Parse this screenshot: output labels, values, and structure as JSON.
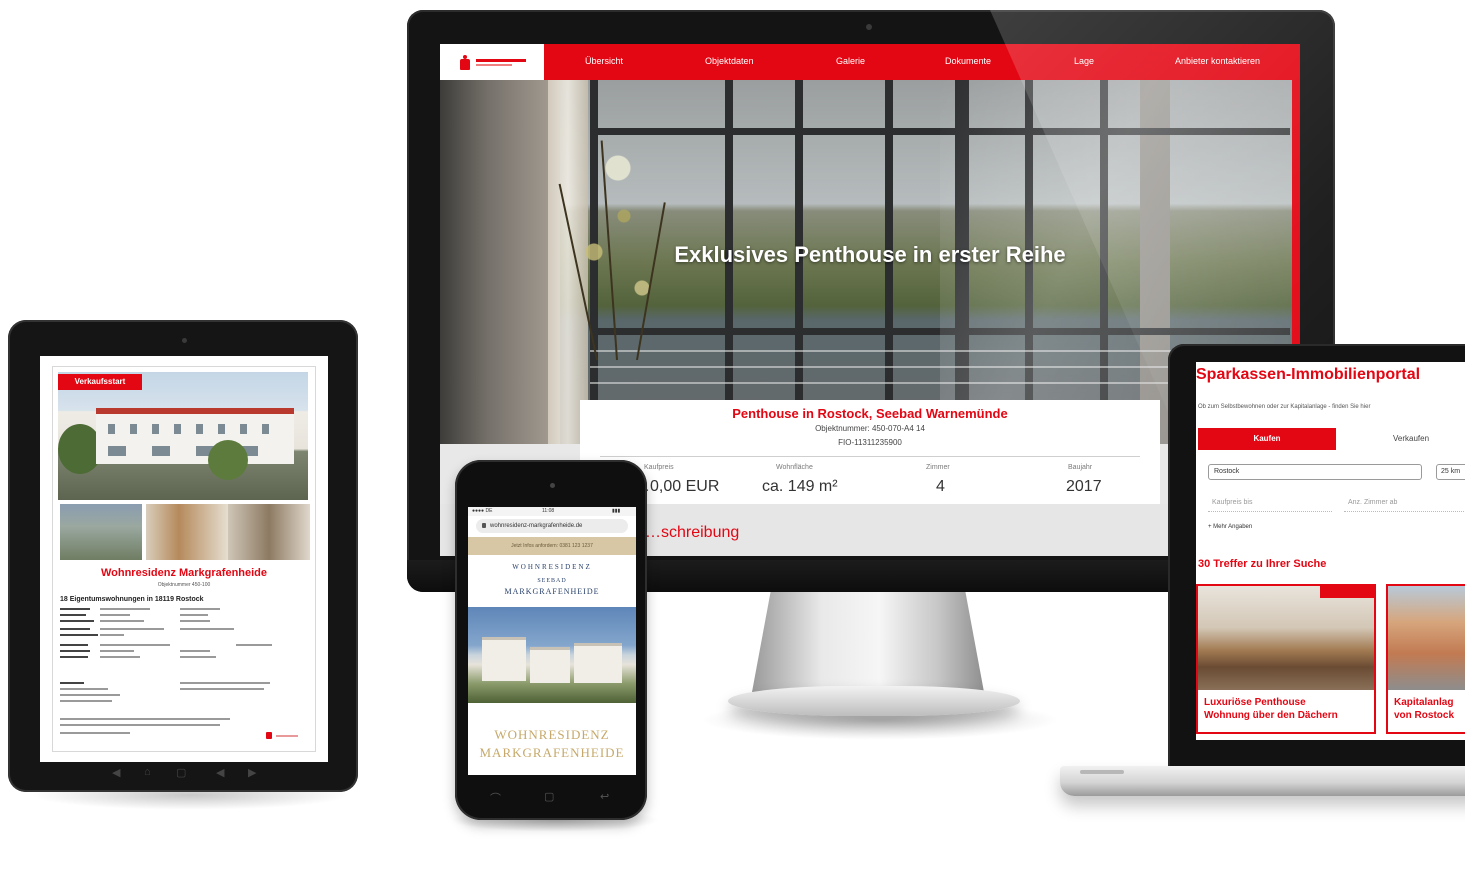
{
  "monitor": {
    "nav": {
      "logo_label": "Sparkasse logo",
      "items": [
        "Übersicht",
        "Objektdaten",
        "Galerie",
        "Dokumente",
        "Lage",
        "Anbieter kontaktieren"
      ]
    },
    "hero_title": "Exklusives Penthouse in erster Reihe",
    "listing": {
      "title": "Penthouse in Rostock, Seebad Warnemünde",
      "object_number": "Objektnummer: 450-070-A4 14",
      "id": "FIO-11311235900",
      "facts": [
        {
          "label": "Kaufpreis",
          "value": "…0,00 EUR"
        },
        {
          "label": "Wohnfläche",
          "value": "ca. 149 m²"
        },
        {
          "label": "Zimmer",
          "value": "4"
        },
        {
          "label": "Baujahr",
          "value": "2017"
        }
      ],
      "description_heading": "…schreibung"
    }
  },
  "tablet": {
    "badge": "Verkaufsstart",
    "title": "Wohnresidenz Markgrafenheide",
    "subtitle": "Objektnummer 450-100",
    "heading": "18 Eigentumswohnungen in 18119 Rostock",
    "nav_glyphs": [
      "◀",
      "⌂",
      "▢",
      "◀",
      "▶"
    ]
  },
  "phone": {
    "status_left": "●●●● DE",
    "status_time": "11:08",
    "status_right": "▮▮▮",
    "url": "wohnresidenz-markgrafenheide.de",
    "banner": "Jetzt Infos anfordern: 0381 123 1237",
    "logo_arc": "WOHNRESIDENZ",
    "logo_small": "SEEBAD",
    "logo_big": "MARKGRAFENHEIDE",
    "title_line1": "WOHNRESIDENZ",
    "title_line2": "MARKGRAFENHEIDE",
    "nav_glyphs": [
      "⌒",
      "▢",
      "↩"
    ]
  },
  "laptop": {
    "title": "Sparkassen-Immobilienportal",
    "subtitle": "Ob zum Selbstbewohnen oder zur Kapitalanlage - finden Sie hier",
    "tabs": {
      "active": "Kaufen",
      "inactive": "Verkaufen"
    },
    "location_value": "Rostock",
    "radius_value": "25 km",
    "price_placeholder": "Kaufpreis bis",
    "rooms_placeholder": "Anz. Zimmer ab",
    "more_options": "+ Mehr Angaben",
    "results_heading": "30 Treffer zu Ihrer Suche",
    "cards": [
      {
        "title_line1": "Luxuriöse Penthouse",
        "title_line2": "Wohnung über den Dächern"
      },
      {
        "title_line1": "Kapitalanlag",
        "title_line2": "von Rostock"
      }
    ]
  },
  "colors": {
    "brand_red": "#e30613",
    "gold": "#c6a96a",
    "navy": "#28406b"
  }
}
